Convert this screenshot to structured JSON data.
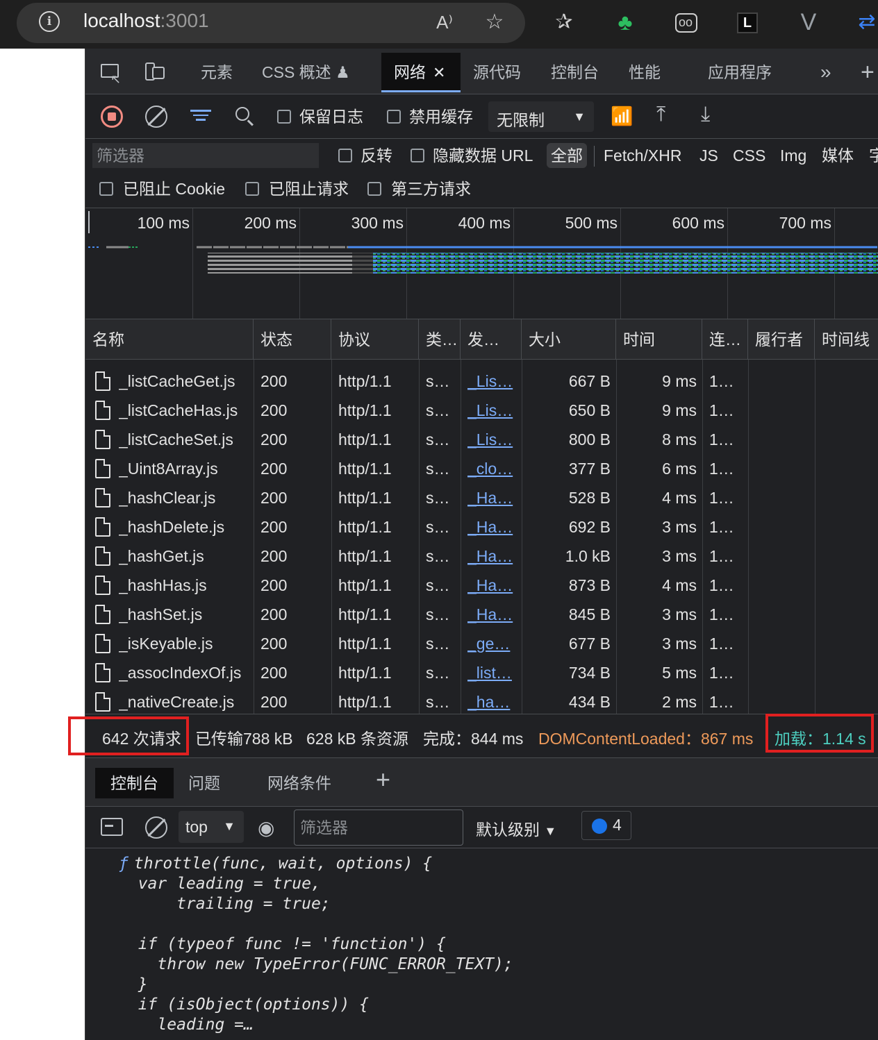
{
  "browser": {
    "url_host": "localhost",
    "url_port": ":3001"
  },
  "devtools": {
    "tabs": [
      {
        "label": "元素"
      },
      {
        "label": "CSS 概述 ♟"
      },
      {
        "label": "网络"
      },
      {
        "label": "源代码"
      },
      {
        "label": "控制台"
      },
      {
        "label": "性能"
      },
      {
        "label": "应用程序"
      }
    ],
    "active_tab": "网络"
  },
  "network": {
    "toolbar": {
      "preserve_log": "保留日志",
      "disable_cache": "禁用缓存",
      "throttling": "无限制"
    },
    "filter": {
      "placeholder": "筛选器",
      "invert": "反转",
      "hide_data_urls": "隐藏数据 URL",
      "types": [
        "全部",
        "Fetch/XHR",
        "JS",
        "CSS",
        "Img",
        "媒体",
        "字"
      ],
      "blocked_cookies": "已阻止 Cookie",
      "blocked_requests": "已阻止请求",
      "third_party": "第三方请求"
    },
    "overview": {
      "ticks": [
        "100 ms",
        "200 ms",
        "300 ms",
        "400 ms",
        "500 ms",
        "600 ms",
        "700 ms"
      ]
    },
    "columns": [
      "名称",
      "状态",
      "协议",
      "类…",
      "发…",
      "大小",
      "时间",
      "连…",
      "履行者",
      "时间线"
    ],
    "rows": [
      {
        "name": "_listCacheGet.js",
        "status": "200",
        "protocol": "http/1.1",
        "type": "s…",
        "initiator": "_Lis…",
        "size": "667 B",
        "time": "9 ms",
        "conn": "1…"
      },
      {
        "name": "_listCacheHas.js",
        "status": "200",
        "protocol": "http/1.1",
        "type": "s…",
        "initiator": "_Lis…",
        "size": "650 B",
        "time": "9 ms",
        "conn": "1…"
      },
      {
        "name": "_listCacheSet.js",
        "status": "200",
        "protocol": "http/1.1",
        "type": "s…",
        "initiator": "_Lis…",
        "size": "800 B",
        "time": "8 ms",
        "conn": "1…"
      },
      {
        "name": "_Uint8Array.js",
        "status": "200",
        "protocol": "http/1.1",
        "type": "s…",
        "initiator": "_clo…",
        "size": "377 B",
        "time": "6 ms",
        "conn": "1…"
      },
      {
        "name": "_hashClear.js",
        "status": "200",
        "protocol": "http/1.1",
        "type": "s…",
        "initiator": "_Ha…",
        "size": "528 B",
        "time": "4 ms",
        "conn": "1…"
      },
      {
        "name": "_hashDelete.js",
        "status": "200",
        "protocol": "http/1.1",
        "type": "s…",
        "initiator": "_Ha…",
        "size": "692 B",
        "time": "3 ms",
        "conn": "1…"
      },
      {
        "name": "_hashGet.js",
        "status": "200",
        "protocol": "http/1.1",
        "type": "s…",
        "initiator": "_Ha…",
        "size": "1.0 kB",
        "time": "3 ms",
        "conn": "1…"
      },
      {
        "name": "_hashHas.js",
        "status": "200",
        "protocol": "http/1.1",
        "type": "s…",
        "initiator": "_Ha…",
        "size": "873 B",
        "time": "4 ms",
        "conn": "1…"
      },
      {
        "name": "_hashSet.js",
        "status": "200",
        "protocol": "http/1.1",
        "type": "s…",
        "initiator": "_Ha…",
        "size": "845 B",
        "time": "3 ms",
        "conn": "1…"
      },
      {
        "name": "_isKeyable.js",
        "status": "200",
        "protocol": "http/1.1",
        "type": "s…",
        "initiator": "_ge…",
        "size": "677 B",
        "time": "3 ms",
        "conn": "1…"
      },
      {
        "name": "_assocIndexOf.js",
        "status": "200",
        "protocol": "http/1.1",
        "type": "s…",
        "initiator": "_list…",
        "size": "734 B",
        "time": "5 ms",
        "conn": "1…"
      },
      {
        "name": "_nativeCreate.js",
        "status": "200",
        "protocol": "http/1.1",
        "type": "s…",
        "initiator": "_ha…",
        "size": "434 B",
        "time": "2 ms",
        "conn": "1…"
      }
    ],
    "summary": {
      "requests": "642 次请求",
      "transferred": "已传输788 kB",
      "resources": "628 kB 条资源",
      "finish": "完成：844 ms",
      "dcl": "DOMContentLoaded：867 ms",
      "load": "加载：1.14 s"
    }
  },
  "drawer": {
    "tabs": [
      "控制台",
      "问题",
      "网络条件"
    ],
    "context": "top",
    "filter_placeholder": "筛选器",
    "level": "默认级别",
    "message_count": "4",
    "code_symbol": "ƒ",
    "code": "throttle(func, wait, options) {\n  var leading = true,\n      trailing = true;\n\n  if (typeof func != 'function') {\n    throw new TypeError(FUNC_ERROR_TEXT);\n  }\n  if (isObject(options)) {\n    leading =…"
  },
  "colors": {
    "accent": "#7cacf8",
    "record": "#f28b82",
    "dcl": "#ee9a5a",
    "load": "#4dcfc0",
    "highlight": "#e02020"
  }
}
